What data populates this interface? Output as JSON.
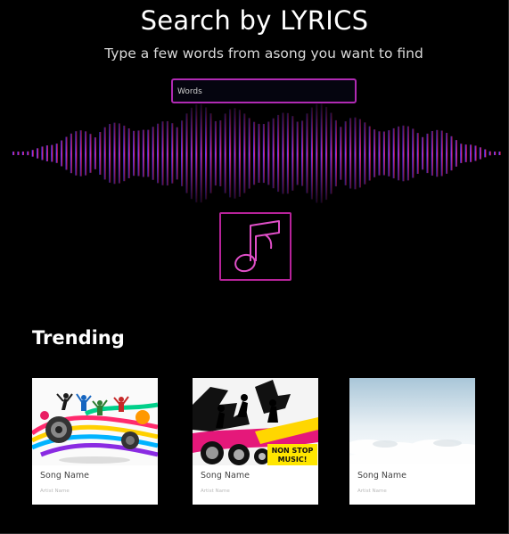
{
  "header": {
    "title": "Search by LYRICS",
    "subtitle": "Type a few words from asong you want to find"
  },
  "search": {
    "placeholder": "Words",
    "value": ""
  },
  "music_button": {
    "icon": "music-note-icon",
    "color": "#e04fc8"
  },
  "trending": {
    "title": "Trending",
    "cards": [
      {
        "song": "Song Name",
        "artist": "Artist Name",
        "image": "dancers-speakers-image"
      },
      {
        "song": "Song Name",
        "artist": "Artist Name",
        "image": "non-stop-music-image"
      },
      {
        "song": "Song Name",
        "artist": "Artist Name",
        "image": "clouds-sky-image"
      }
    ]
  },
  "colors": {
    "accent": "#b02ab3",
    "wave_left": "#3b3cff",
    "wave_mid": "#c23acb",
    "wave_right": "#e0143a"
  }
}
